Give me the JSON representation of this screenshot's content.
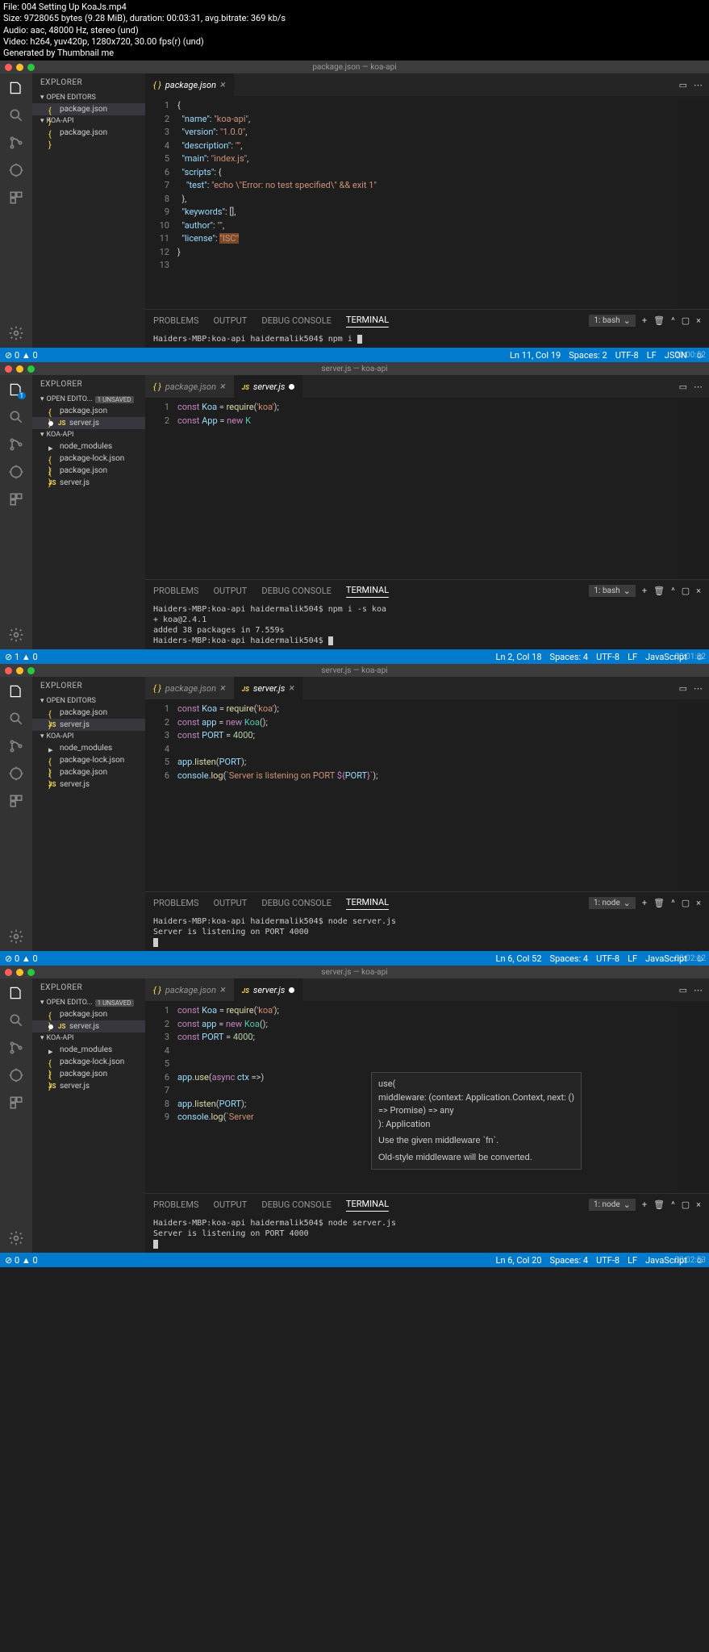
{
  "meta": {
    "line1": "File: 004 Setting Up KoaJs.mp4",
    "line2": "Size: 9728065 bytes (9.28 MiB), duration: 00:03:31, avg.bitrate: 369 kb/s",
    "line3": "Audio: aac, 48000 Hz, stereo (und)",
    "line4": "Video: h264, yuv420p, 1280x720, 30.00 fps(r) (und)",
    "line5": "Generated by Thumbnail me"
  },
  "frames": [
    {
      "title": "package.json — koa-api",
      "explorer": "EXPLORER",
      "open_editors": "OPEN EDITORS",
      "project": "KOA-API",
      "files_open": [
        "package.json"
      ],
      "files_tree": [
        "package.json"
      ],
      "tabs": [
        {
          "name": "package.json",
          "active": true
        }
      ],
      "gutter": [
        "1",
        "2",
        "3",
        "4",
        "5",
        "6",
        "7",
        "8",
        "9",
        "10",
        "11",
        "12",
        "13"
      ],
      "code_html": "<span class='pun'>{</span>\n  <span class='prop'>\"name\"</span>: <span class='str'>\"koa-api\"</span>,\n  <span class='prop'>\"version\"</span>: <span class='str'>\"1.0.0\"</span>,\n  <span class='prop'>\"description\"</span>: <span class='str'>\"\"</span>,\n  <span class='prop'>\"main\"</span>: <span class='str'>\"index.js\"</span>,\n  <span class='prop'>\"scripts\"</span>: {\n    <span class='prop'>\"test\"</span>: <span class='str'>\"echo \\\"Error: no test specified\\\" && exit 1\"</span>\n  },\n  <span class='prop'>\"keywords\"</span>: [],\n  <span class='prop'>\"author\"</span>: <span class='str'>\"\"</span>,\n  <span class='prop'>\"license\"</span>: <span style='background:#7a4a2a'><span class='str'>\"ISC\"</span></span>\n<span class='pun'>}</span>\n",
      "panel_tabs": [
        "PROBLEMS",
        "OUTPUT",
        "DEBUG CONSOLE",
        "TERMINAL"
      ],
      "panel_active": 3,
      "terminal_dd": "1: bash",
      "terminal": "Haiders-MBP:koa-api haidermalik504$ npm i ",
      "status_left": "⊘ 0 ▲ 0",
      "status_right": [
        "Ln 11, Col 19",
        "Spaces: 2",
        "UTF-8",
        "LF",
        "JSON"
      ],
      "timestamp": "00:00:52",
      "unsaved": ""
    },
    {
      "title": "server.js — koa-api",
      "explorer": "EXPLORER",
      "open_editors": "OPEN EDITO...",
      "unsaved": "1 UNSAVED",
      "project": "KOA-API",
      "files_open": [
        "package.json",
        "server.js"
      ],
      "files_tree": [
        "node_modules",
        "package-lock.json",
        "package.json",
        "server.js"
      ],
      "tabs": [
        {
          "name": "package.json"
        },
        {
          "name": "server.js",
          "active": true,
          "modified": true
        }
      ],
      "gutter": [
        "1",
        "2"
      ],
      "code_html": "<span class='kw'>const</span> <span class='var'>Koa</span> = <span class='fn'>require</span>(<span class='str'>'koa'</span>);\n<span class='kw'>const</span> <span class='var'>App</span> = <span class='kw'>new</span> <span class='cls'>K</span>",
      "panel_tabs": [
        "PROBLEMS",
        "OUTPUT",
        "DEBUG CONSOLE",
        "TERMINAL"
      ],
      "panel_active": 3,
      "terminal_dd": "1: bash",
      "terminal": "Haiders-MBP:koa-api haidermalik504$ npm i -s koa\n+ koa@2.4.1\nadded 38 packages in 7.559s\nHaiders-MBP:koa-api haidermalik504$ ",
      "status_left": "⊘ 1 ▲ 0",
      "status_right": [
        "Ln 2, Col 18",
        "Spaces: 4",
        "UTF-8",
        "LF",
        "JavaScript"
      ],
      "timestamp": "00:01:32"
    },
    {
      "title": "server.js — koa-api",
      "explorer": "EXPLORER",
      "open_editors": "OPEN EDITORS",
      "project": "KOA-API",
      "files_open": [
        "package.json",
        "server.js"
      ],
      "files_tree": [
        "node_modules",
        "package-lock.json",
        "package.json",
        "server.js"
      ],
      "tabs": [
        {
          "name": "package.json"
        },
        {
          "name": "server.js",
          "active": true
        }
      ],
      "gutter": [
        "1",
        "2",
        "3",
        "4",
        "5",
        "6"
      ],
      "code_html": "<span class='kw'>const</span> <span class='var'>Koa</span> = <span class='fn'>require</span>(<span class='str'>'koa'</span>);\n<span class='kw'>const</span> <span class='var'>app</span> = <span class='kw'>new</span> <span class='cls'>Koa</span>();\n<span class='kw'>const</span> <span class='var'>PORT</span> = <span class='num'>4000</span>;\n\n<span class='var'>app</span>.<span class='fn'>listen</span>(<span class='var'>PORT</span>);\n<span class='var'>console</span>.<span class='fn'>log</span>(<span class='str'>`Server is listening on PORT </span><span class='kw'>${</span><span class='var'>PORT</span><span class='kw'>}</span><span class='str'>`</span>);",
      "panel_tabs": [
        "PROBLEMS",
        "OUTPUT",
        "DEBUG CONSOLE",
        "TERMINAL"
      ],
      "panel_active": 3,
      "terminal_dd": "1: node",
      "terminal": "Haiders-MBP:koa-api haidermalik504$ node server.js\nServer is listening on PORT 4000\n",
      "status_left": "⊘ 0 ▲ 0",
      "status_right": [
        "Ln 6, Col 52",
        "Spaces: 4",
        "UTF-8",
        "LF",
        "JavaScript"
      ],
      "timestamp": "00:02:12",
      "unsaved": ""
    },
    {
      "title": "server.js — koa-api",
      "explorer": "EXPLORER",
      "open_editors": "OPEN EDITO...",
      "unsaved": "1 UNSAVED",
      "project": "KOA-API",
      "files_open": [
        "package.json",
        "server.js"
      ],
      "files_tree": [
        "node_modules",
        "package-lock.json",
        "package.json",
        "server.js"
      ],
      "tabs": [
        {
          "name": "package.json"
        },
        {
          "name": "server.js",
          "active": true,
          "modified": true
        }
      ],
      "gutter": [
        "1",
        "2",
        "3",
        "4",
        "5",
        "6",
        "7",
        "8",
        "9"
      ],
      "code_html": "<span class='kw'>const</span> <span class='var'>Koa</span> = <span class='fn'>require</span>(<span class='str'>'koa'</span>);\n<span class='kw'>const</span> <span class='var'>app</span> = <span class='kw'>new</span> <span class='cls'>Koa</span>();\n<span class='kw'>const</span> <span class='var'>PORT</span> = <span class='num'>4000</span>;\n\n\n<span class='var'>app</span>.<span class='fn'>use</span>(<span class='kw'>async</span> <span class='var'>ctx</span> =>)\n\n<span class='var'>app</span>.<span class='fn'>listen</span>(<span class='var'>PORT</span>);\n<span class='var'>console</span>.<span class='fn'>log</span>(<span class='str'>`Server</span>",
      "tooltip": {
        "sig": "use(\nmiddleware: (context: Application.Context, next: ()\n=> Promise<any>) => any\n): Application",
        "desc1": "Use the given middleware `fn`.",
        "desc2": "Old-style middleware will be converted."
      },
      "panel_tabs": [
        "PROBLEMS",
        "OUTPUT",
        "DEBUG CONSOLE",
        "TERMINAL"
      ],
      "panel_active": 3,
      "terminal_dd": "1: node",
      "terminal": "Haiders-MBP:koa-api haidermalik504$ node server.js\nServer is listening on PORT 4000\n",
      "status_left": "⊘ 0 ▲ 0",
      "status_right": [
        "Ln 6, Col 20",
        "Spaces: 4",
        "UTF-8",
        "LF",
        "JavaScript"
      ],
      "timestamp": "00:02:53"
    }
  ]
}
